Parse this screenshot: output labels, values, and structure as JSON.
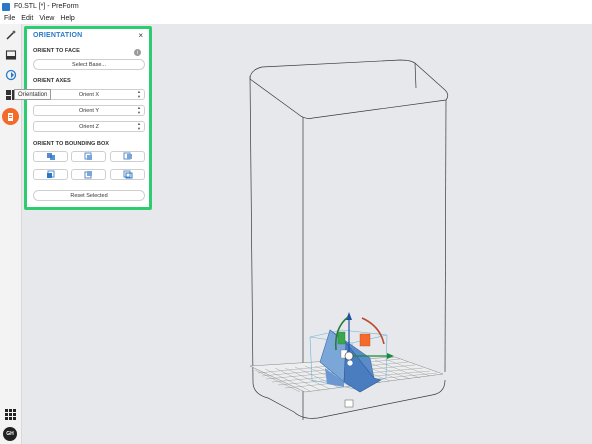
{
  "window": {
    "title": "F0.STL [*] - PreForm"
  },
  "menu": [
    "File",
    "Edit",
    "View",
    "Help"
  ],
  "toolbar": {
    "tooltip": "Orientation",
    "user_initials": "GH"
  },
  "panel": {
    "title": "ORIENTATION",
    "close": "×",
    "orient_to_face": {
      "title": "ORIENT TO FACE",
      "button": "Select Base..."
    },
    "orient_axes": {
      "title": "ORIENT AXES",
      "x": "Orient X",
      "y": "Orient Y",
      "z": "Orient Z"
    },
    "bounding_box": {
      "title": "ORIENT TO BOUNDING BOX"
    },
    "reset": "Reset Selected"
  },
  "colors": {
    "accent": "#2a78c7",
    "highlight": "#2ecc71",
    "alert": "#f26b2a",
    "viewport": "#e6e8eb"
  }
}
